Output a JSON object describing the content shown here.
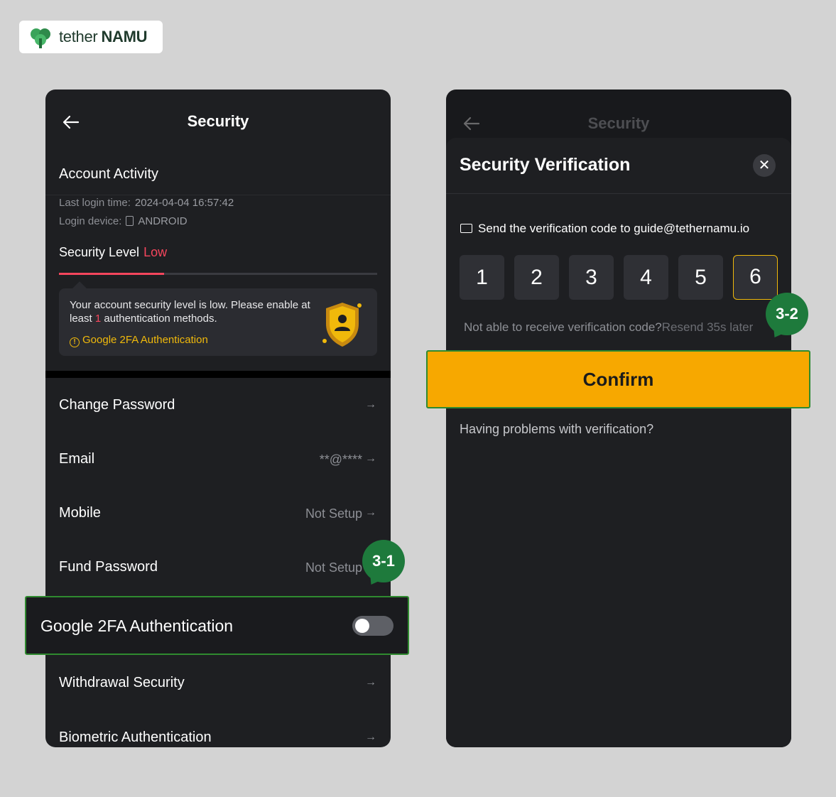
{
  "brand": {
    "name_part1": "tether",
    "name_part2": "NAMU"
  },
  "left": {
    "title": "Security",
    "account_activity": "Account Activity",
    "last_login_label": "Last login time:",
    "last_login_value": "2024-04-04 16:57:42",
    "device_label": "Login device:",
    "device_value": "ANDROID",
    "security_level_label": "Security Level",
    "security_level_value": "Low",
    "security_level_progress": 0.33,
    "tip_text_a": "Your account security level is low. Please enable at least ",
    "tip_text_num": "1",
    "tip_text_b": " authentication methods.",
    "tip_link": "Google 2FA Authentication",
    "rows": [
      {
        "label": "Change Password",
        "value": ""
      },
      {
        "label": "Email",
        "value": "**@****"
      },
      {
        "label": "Mobile",
        "value": "Not Setup"
      },
      {
        "label": "Fund Password",
        "value": "Not Setup"
      },
      {
        "label": "Withdrawal Security",
        "value": ""
      },
      {
        "label": "Biometric Authentication",
        "value": ""
      }
    ],
    "google_2fa": {
      "label": "Google 2FA Authentication",
      "enabled": false
    },
    "arrow": "→"
  },
  "right": {
    "title": "Security",
    "sheet_title": "Security Verification",
    "close": "✕",
    "send_text": "Send the verification code to guide@tethernamu.io",
    "code": [
      "1",
      "2",
      "3",
      "4",
      "5",
      "6"
    ],
    "not_able": "Not able to receive verification code?",
    "resend": "Resend 35s later",
    "confirm": "Confirm",
    "having_problems": "Having problems with verification?"
  },
  "badges": {
    "b1": "3-1",
    "b2": "3-2"
  },
  "colors": {
    "accent_yellow": "#f7a800",
    "danger": "#f6465d",
    "highlight_green": "#2f8a2f",
    "badge_green": "#1e7a3c"
  }
}
